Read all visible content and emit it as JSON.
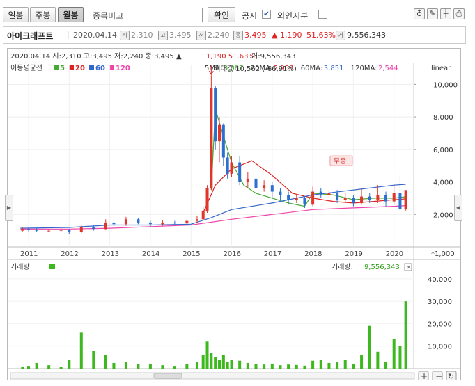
{
  "toolbar": {
    "tabs": [
      "일봉",
      "주봉",
      "월봉"
    ],
    "compare_label": "종목비교",
    "confirm_label": "확인",
    "disclosure_label": "공시",
    "foreign_label": "외인지분"
  },
  "stock": {
    "name": "아이크래프트",
    "date": "2020.04.14",
    "open": "2,310",
    "high": "3,495",
    "low": "2,240",
    "close": "3,495",
    "change": "▲ 1,190",
    "change_pct": "51.63%",
    "volume": "9,556,343"
  },
  "header": {
    "summary": "2020.04.14 시:2,310 고:3,495 저:2,240 종:3,495 ▲",
    "change": "1,190  51.63%",
    "volume": "거:9,556,343"
  },
  "ma_legend": {
    "title": "이동평균선",
    "items": [
      {
        "label": "5",
        "color": "#44aa33"
      },
      {
        "label": "20",
        "color": "#dd2222"
      },
      {
        "label": "60",
        "color": "#3366cc"
      },
      {
        "label": "120",
        "color": "#ee44aa"
      }
    ],
    "values": [
      {
        "label": "5MA:",
        "value": "3,087",
        "color": "#44aa33"
      },
      {
        "label": "20MA:",
        "value": "2,958",
        "color": "#dd2222"
      },
      {
        "label": "60MA:",
        "value": "3,851",
        "color": "#3366cc"
      },
      {
        "label": "120MA:",
        "value": "2,544",
        "color": "#ee44aa"
      }
    ]
  },
  "scale_label": "linear",
  "max_annotation": "최대값 10,562 (-66,91%)",
  "free_issue_label": "무증",
  "volume_panel": {
    "title": "거래량",
    "value_label": "거래량:",
    "value": "9,556,343",
    "unit": "*1,000"
  },
  "chart_data": [
    {
      "type": "candlestick",
      "title": "",
      "x_ticks": [
        "2011",
        "2012",
        "2013",
        "2014",
        "2015",
        "2016",
        "2017",
        "2018",
        "2019",
        "2020"
      ],
      "y_ticks": [
        "2,000",
        "4,000",
        "6,000",
        "8,000",
        "10,000"
      ],
      "ylim": [
        0,
        11000
      ],
      "period": "monthly",
      "series": [
        {
          "name": "5",
          "type": "line",
          "color": "#44aa33",
          "x": [
            2015.5,
            2015.6,
            2015.8,
            2016.0,
            2016.3,
            2016.6,
            2017.0,
            2017.4,
            2017.8,
            2018.0,
            2018.5,
            2019.0,
            2019.5,
            2020.0,
            2020.29
          ],
          "values": [
            3500,
            8500,
            6800,
            5200,
            3800,
            3300,
            3000,
            2700,
            2500,
            3300,
            3200,
            2900,
            3000,
            3000,
            3087
          ]
        },
        {
          "name": "20",
          "type": "line",
          "color": "#dd2222",
          "x": [
            2015.3,
            2015.6,
            2016.0,
            2016.5,
            2017.0,
            2017.5,
            2018.0,
            2018.5,
            2019.0,
            2019.5,
            2020.0,
            2020.29
          ],
          "values": [
            2100,
            3800,
            4800,
            5300,
            4400,
            3300,
            3000,
            2800,
            2700,
            2800,
            2900,
            2958
          ]
        },
        {
          "name": "60",
          "type": "line",
          "color": "#3366cc",
          "x": [
            2010.8,
            2012.0,
            2013.0,
            2014.0,
            2015.0,
            2015.5,
            2016.0,
            2017.0,
            2018.0,
            2019.0,
            2020.0,
            2020.29
          ],
          "values": [
            1150,
            1200,
            1350,
            1350,
            1400,
            1800,
            2300,
            2700,
            3200,
            3500,
            3800,
            3851
          ]
        },
        {
          "name": "120",
          "type": "line",
          "color": "#ee44aa",
          "x": [
            2010.8,
            2012.0,
            2013.0,
            2014.0,
            2015.0,
            2016.0,
            2017.0,
            2018.0,
            2019.0,
            2020.0,
            2020.29
          ],
          "values": [
            1100,
            1100,
            1150,
            1250,
            1350,
            1700,
            2000,
            2300,
            2400,
            2500,
            2544
          ]
        }
      ],
      "candles": [
        {
          "t": 2010.85,
          "o": 1000,
          "c": 1100,
          "h": 1200,
          "l": 950
        },
        {
          "t": 2011.0,
          "o": 1100,
          "c": 1050,
          "h": 1200,
          "l": 950
        },
        {
          "t": 2011.2,
          "o": 1050,
          "c": 1000,
          "h": 1150,
          "l": 900
        },
        {
          "t": 2011.5,
          "o": 1000,
          "c": 1000,
          "h": 1100,
          "l": 900
        },
        {
          "t": 2011.8,
          "o": 1000,
          "c": 1050,
          "h": 1150,
          "l": 900
        },
        {
          "t": 2012.0,
          "o": 1050,
          "c": 900,
          "h": 1100,
          "l": 800
        },
        {
          "t": 2012.3,
          "o": 900,
          "c": 1200,
          "h": 1350,
          "l": 850
        },
        {
          "t": 2012.6,
          "o": 1200,
          "c": 1100,
          "h": 1350,
          "l": 1000
        },
        {
          "t": 2012.9,
          "o": 1100,
          "c": 1500,
          "h": 1700,
          "l": 1050
        },
        {
          "t": 2013.1,
          "o": 1500,
          "c": 1400,
          "h": 1700,
          "l": 1300
        },
        {
          "t": 2013.4,
          "o": 1400,
          "c": 1700,
          "h": 1850,
          "l": 1300
        },
        {
          "t": 2013.7,
          "o": 1700,
          "c": 1500,
          "h": 1800,
          "l": 1400
        },
        {
          "t": 2014.0,
          "o": 1500,
          "c": 1400,
          "h": 1600,
          "l": 1200
        },
        {
          "t": 2014.3,
          "o": 1400,
          "c": 1500,
          "h": 1650,
          "l": 1300
        },
        {
          "t": 2014.6,
          "o": 1500,
          "c": 1450,
          "h": 1600,
          "l": 1350
        },
        {
          "t": 2014.9,
          "o": 1450,
          "c": 1600,
          "h": 1700,
          "l": 1400
        },
        {
          "t": 2015.15,
          "o": 1600,
          "c": 1700,
          "h": 1900,
          "l": 1500
        },
        {
          "t": 2015.3,
          "o": 1700,
          "c": 2200,
          "h": 2500,
          "l": 1650
        },
        {
          "t": 2015.4,
          "o": 2200,
          "c": 3600,
          "h": 3800,
          "l": 2100
        },
        {
          "t": 2015.5,
          "o": 3600,
          "c": 9800,
          "h": 10562,
          "l": 3500
        },
        {
          "t": 2015.6,
          "o": 9800,
          "c": 6500,
          "h": 9900,
          "l": 6000
        },
        {
          "t": 2015.7,
          "o": 6500,
          "c": 7500,
          "h": 8000,
          "l": 5200
        },
        {
          "t": 2015.8,
          "o": 7500,
          "c": 5500,
          "h": 7600,
          "l": 5000
        },
        {
          "t": 2015.9,
          "o": 5500,
          "c": 4500,
          "h": 5800,
          "l": 4200
        },
        {
          "t": 2016.0,
          "o": 4500,
          "c": 5200,
          "h": 5600,
          "l": 4300
        },
        {
          "t": 2016.2,
          "o": 5200,
          "c": 4000,
          "h": 5600,
          "l": 3800
        },
        {
          "t": 2016.4,
          "o": 4000,
          "c": 4200,
          "h": 4600,
          "l": 3600
        },
        {
          "t": 2016.6,
          "o": 4200,
          "c": 3600,
          "h": 4400,
          "l": 3400
        },
        {
          "t": 2016.8,
          "o": 3600,
          "c": 3800,
          "h": 4100,
          "l": 3400
        },
        {
          "t": 2017.0,
          "o": 3800,
          "c": 3400,
          "h": 4000,
          "l": 3000
        },
        {
          "t": 2017.2,
          "o": 3400,
          "c": 3200,
          "h": 3600,
          "l": 2900
        },
        {
          "t": 2017.4,
          "o": 3200,
          "c": 2900,
          "h": 3400,
          "l": 2600
        },
        {
          "t": 2017.6,
          "o": 2900,
          "c": 3000,
          "h": 3200,
          "l": 2700
        },
        {
          "t": 2017.8,
          "o": 3000,
          "c": 2600,
          "h": 3100,
          "l": 2400
        },
        {
          "t": 2018.0,
          "o": 2600,
          "c": 3400,
          "h": 3700,
          "l": 2500
        },
        {
          "t": 2018.2,
          "o": 3400,
          "c": 3200,
          "h": 3600,
          "l": 3000
        },
        {
          "t": 2018.4,
          "o": 3200,
          "c": 3300,
          "h": 3500,
          "l": 3000
        },
        {
          "t": 2018.6,
          "o": 3300,
          "c": 2900,
          "h": 3500,
          "l": 2700
        },
        {
          "t": 2018.8,
          "o": 2900,
          "c": 3000,
          "h": 3300,
          "l": 2700
        },
        {
          "t": 2019.0,
          "o": 3000,
          "c": 2700,
          "h": 3200,
          "l": 2500
        },
        {
          "t": 2019.2,
          "o": 2700,
          "c": 3100,
          "h": 3600,
          "l": 2600
        },
        {
          "t": 2019.4,
          "o": 3100,
          "c": 2900,
          "h": 3300,
          "l": 2700
        },
        {
          "t": 2019.6,
          "o": 2900,
          "c": 3200,
          "h": 3800,
          "l": 2700
        },
        {
          "t": 2019.8,
          "o": 3200,
          "c": 2800,
          "h": 3400,
          "l": 2500
        },
        {
          "t": 2020.0,
          "o": 2800,
          "c": 3300,
          "h": 3900,
          "l": 2600
        },
        {
          "t": 2020.15,
          "o": 3300,
          "c": 2310,
          "h": 4400,
          "l": 2200
        },
        {
          "t": 2020.29,
          "o": 2310,
          "c": 3495,
          "h": 3495,
          "l": 2240
        }
      ]
    },
    {
      "type": "bar",
      "title": "거래량",
      "unit": "*1,000",
      "y_ticks": [
        "10,000",
        "20,000",
        "30,000",
        "40,000"
      ],
      "ylim": [
        0,
        48000
      ],
      "x": [
        2010.85,
        2011.0,
        2011.2,
        2011.5,
        2011.8,
        2012.0,
        2012.3,
        2012.6,
        2012.9,
        2013.1,
        2013.4,
        2013.7,
        2014.0,
        2014.3,
        2014.6,
        2014.9,
        2015.15,
        2015.3,
        2015.4,
        2015.5,
        2015.6,
        2015.7,
        2015.8,
        2015.9,
        2016.0,
        2016.2,
        2016.4,
        2016.6,
        2016.8,
        2017.0,
        2017.2,
        2017.4,
        2017.6,
        2017.8,
        2018.0,
        2018.2,
        2018.4,
        2018.6,
        2018.8,
        2019.0,
        2019.2,
        2019.4,
        2019.6,
        2019.8,
        2020.0,
        2020.15,
        2020.29
      ],
      "values": [
        800,
        1200,
        2500,
        1500,
        900,
        4000,
        16000,
        8000,
        6000,
        2500,
        3000,
        2000,
        2000,
        1500,
        1200,
        2000,
        3000,
        6000,
        12000,
        7000,
        5000,
        4000,
        6000,
        3000,
        4000,
        3500,
        2500,
        2000,
        1800,
        2200,
        1500,
        1800,
        1600,
        1300,
        3500,
        4000,
        2500,
        3000,
        3800,
        2000,
        6000,
        19000,
        7500,
        3000,
        13000,
        10000,
        30000
      ]
    }
  ]
}
